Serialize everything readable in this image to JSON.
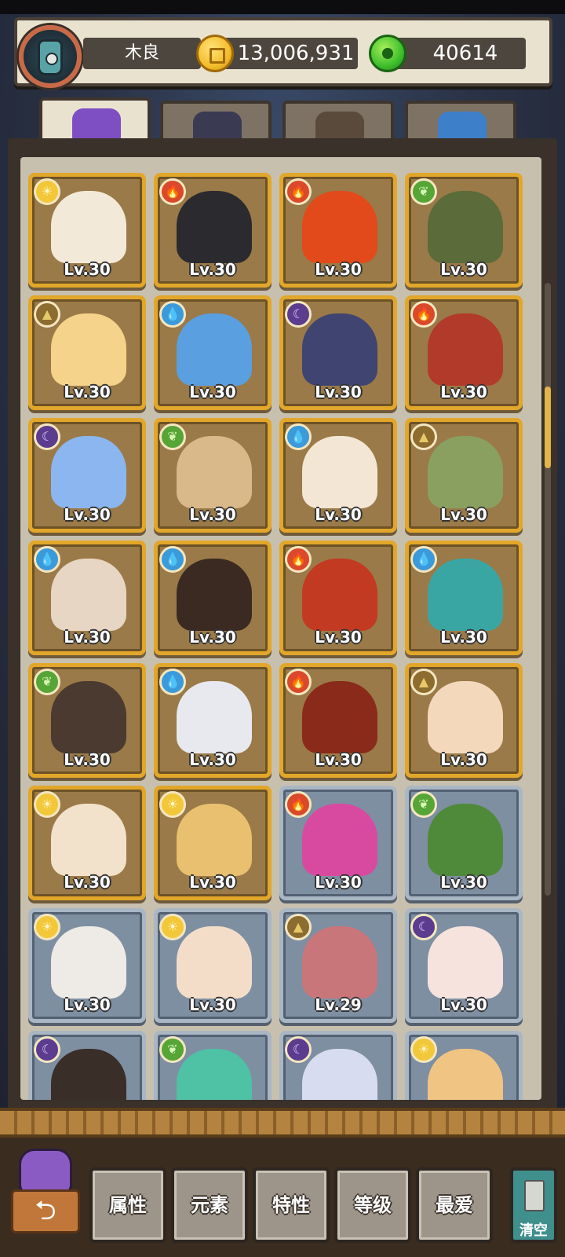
{
  "header": {
    "player_name": "木良",
    "coins": "13,006,931",
    "jade": "40614"
  },
  "tabs": [
    {
      "name": "characters",
      "icon": "demon-face-icon",
      "active": true
    },
    {
      "name": "artifacts",
      "icon": "scroll-peacock-icon",
      "active": false
    },
    {
      "name": "food",
      "icon": "noodle-bowl-icon",
      "active": false
    },
    {
      "name": "crystals",
      "icon": "blue-crystal-icon",
      "active": false
    }
  ],
  "colors": {
    "gold_frame": "#e2a72a",
    "silver_frame": "#a9b6c4",
    "panel_bg": "#c8c0ae"
  },
  "cards": [
    {
      "element": "sun",
      "level": "Lv.30",
      "frame": "gold",
      "color": "#f3e9d8"
    },
    {
      "element": "fire",
      "level": "Lv.30",
      "frame": "gold",
      "color": "#2b2a2f"
    },
    {
      "element": "fire",
      "level": "Lv.30",
      "frame": "gold",
      "color": "#e24a1c"
    },
    {
      "element": "leaf",
      "level": "Lv.30",
      "frame": "gold",
      "color": "#5b6b3a"
    },
    {
      "element": "earth",
      "level": "Lv.30",
      "frame": "gold",
      "color": "#f5d38a"
    },
    {
      "element": "water",
      "level": "Lv.30",
      "frame": "gold",
      "color": "#5a9fe0"
    },
    {
      "element": "moon",
      "level": "Lv.30",
      "frame": "gold",
      "color": "#3f4470"
    },
    {
      "element": "fire",
      "level": "Lv.30",
      "frame": "gold",
      "color": "#b23a2a"
    },
    {
      "element": "moon",
      "level": "Lv.30",
      "frame": "gold",
      "color": "#8bb6ef"
    },
    {
      "element": "leaf",
      "level": "Lv.30",
      "frame": "gold",
      "color": "#d9b98a"
    },
    {
      "element": "water",
      "level": "Lv.30",
      "frame": "gold",
      "color": "#f3e6d4"
    },
    {
      "element": "earth",
      "level": "Lv.30",
      "frame": "gold",
      "color": "#8aa060"
    },
    {
      "element": "water",
      "level": "Lv.30",
      "frame": "gold",
      "color": "#e8d6c4"
    },
    {
      "element": "water",
      "level": "Lv.30",
      "frame": "gold",
      "color": "#3a2a22"
    },
    {
      "element": "fire",
      "level": "Lv.30",
      "frame": "gold",
      "color": "#c23a22"
    },
    {
      "element": "water",
      "level": "Lv.30",
      "frame": "gold",
      "color": "#3aa6a4"
    },
    {
      "element": "leaf",
      "level": "Lv.30",
      "frame": "gold",
      "color": "#4a3a30"
    },
    {
      "element": "water",
      "level": "Lv.30",
      "frame": "gold",
      "color": "#e7e9ef"
    },
    {
      "element": "fire",
      "level": "Lv.30",
      "frame": "gold",
      "color": "#8a2a1a"
    },
    {
      "element": "earth",
      "level": "Lv.30",
      "frame": "gold",
      "color": "#f3d8bc"
    },
    {
      "element": "sun",
      "level": "Lv.30",
      "frame": "gold",
      "color": "#f2e1cb"
    },
    {
      "element": "sun",
      "level": "Lv.30",
      "frame": "gold",
      "color": "#e8c070"
    },
    {
      "element": "fire",
      "level": "Lv.30",
      "frame": "silver",
      "color": "#d84aa0"
    },
    {
      "element": "leaf",
      "level": "Lv.30",
      "frame": "silver",
      "color": "#4f8a3a"
    },
    {
      "element": "sun",
      "level": "Lv.30",
      "frame": "silver",
      "color": "#eeeae6"
    },
    {
      "element": "sun",
      "level": "Lv.30",
      "frame": "silver",
      "color": "#f4ddc8"
    },
    {
      "element": "earth",
      "level": "Lv.29",
      "frame": "silver",
      "color": "#c9767a"
    },
    {
      "element": "moon",
      "level": "Lv.30",
      "frame": "silver",
      "color": "#f6e3dd"
    },
    {
      "element": "moon",
      "level": "",
      "frame": "silver",
      "color": "#3a2e28"
    },
    {
      "element": "leaf",
      "level": "",
      "frame": "silver",
      "color": "#4fc1a4"
    },
    {
      "element": "moon",
      "level": "",
      "frame": "silver",
      "color": "#d7dcf0"
    },
    {
      "element": "sun",
      "level": "",
      "frame": "silver",
      "color": "#f0c483"
    }
  ],
  "filters": [
    {
      "label": "属性"
    },
    {
      "label": "元素"
    },
    {
      "label": "特性"
    },
    {
      "label": "等级"
    },
    {
      "label": "最爱"
    }
  ],
  "back_label": "⮌",
  "clear_label": "清空"
}
